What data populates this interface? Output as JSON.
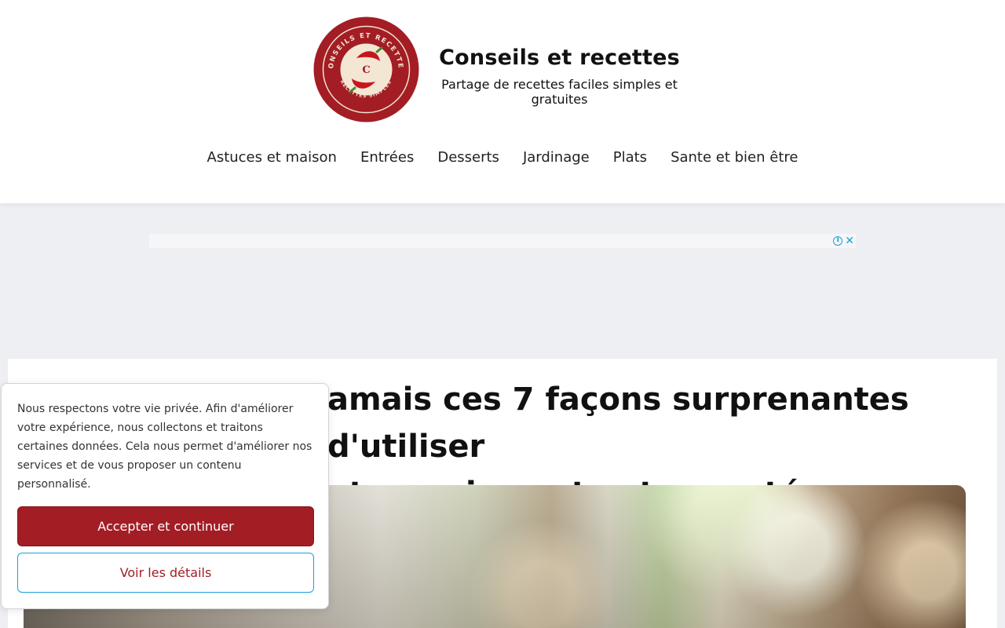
{
  "header": {
    "brand_title": "Conseils et recettes",
    "brand_tagline": "Partage de recettes faciles simples et gratuites",
    "logo": {
      "top_text": "CONSEILS ET RECETTES",
      "bottom_text": "RECETTES SIMPLES",
      "monogram": "C",
      "icon": "chili-pepper-logo"
    }
  },
  "nav": {
    "items": [
      {
        "label": "Astuces et maison"
      },
      {
        "label": "Entrées"
      },
      {
        "label": "Desserts"
      },
      {
        "label": "Jardinage"
      },
      {
        "label": "Plats"
      },
      {
        "label": "Sante et bien être"
      }
    ]
  },
  "ad": {
    "info_icon": "ⓘ",
    "close_icon": "✕"
  },
  "article": {
    "title": "amais ces 7 façons surprenantes d'utiliser otre maison et votre santé"
  },
  "consent": {
    "text": "Nous respectons votre vie privée. Afin d'améliorer votre expérience, nous collectons et traitons certaines données. Cela nous permet d'améliorer nos services et de vous proposer un contenu personnalisé.",
    "accept_label": "Accepter et continuer",
    "details_label": "Voir les détails"
  },
  "colors": {
    "brand_red": "#a31d25",
    "accent_blue": "#1aa0d8",
    "page_bg": "#eeeff3"
  }
}
